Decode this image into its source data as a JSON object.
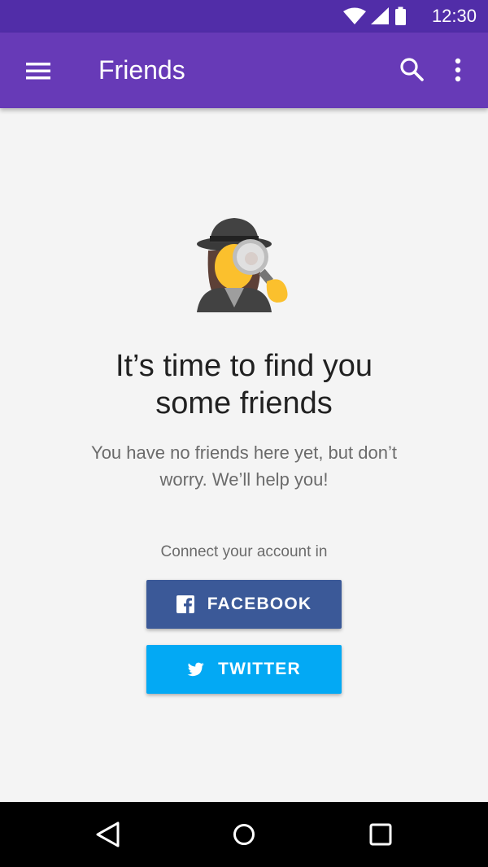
{
  "status_bar": {
    "time": "12:30",
    "icons": [
      "wifi-icon",
      "signal-icon",
      "battery-icon"
    ]
  },
  "app_bar": {
    "title": "Friends",
    "icons": [
      "menu-icon",
      "search-icon",
      "more-vert-icon"
    ]
  },
  "empty_state": {
    "illustration": "detective-woman-emoji",
    "headline_line1": "It’s time to find you",
    "headline_line2": "some friends",
    "subtext_line1": "You have no friends here yet, but don’t",
    "subtext_line2": "worry. We’ll help you!",
    "connect_label": "Connect your account in"
  },
  "buttons": {
    "facebook_label": "FACEBOOK",
    "twitter_label": "TWITTER"
  },
  "nav_bar": {
    "icons": [
      "back-icon",
      "home-icon",
      "recents-icon"
    ]
  },
  "colors": {
    "status_bar": "#512da8",
    "app_bar": "#673ab7",
    "background": "#f4f4f4",
    "facebook": "#3b5998",
    "twitter": "#03a9f4",
    "nav_bar": "#000000"
  }
}
